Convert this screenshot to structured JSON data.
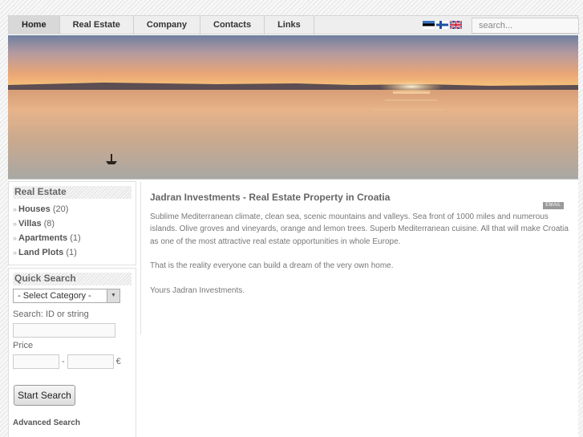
{
  "nav": {
    "items": [
      {
        "label": "Home",
        "active": true
      },
      {
        "label": "Real Estate"
      },
      {
        "label": "Company"
      },
      {
        "label": "Contacts"
      },
      {
        "label": "Links"
      }
    ],
    "flags": [
      "estonia-flag-icon",
      "finland-flag-icon",
      "uk-flag-icon"
    ],
    "search_placeholder": "search..."
  },
  "sidebar": {
    "real_estate": {
      "title": "Real Estate",
      "items": [
        {
          "name": "Houses",
          "count": "(20)"
        },
        {
          "name": "Villas",
          "count": "(8)"
        },
        {
          "name": "Apartments",
          "count": "(1)"
        },
        {
          "name": "Land Plots",
          "count": "(1)"
        }
      ]
    },
    "quick_search": {
      "title": "Quick Search",
      "category_selected": "- Select Category -",
      "search_label": "Search: ID or string",
      "price_label": "Price",
      "price_separator": "-",
      "currency": "€",
      "button": "Start Search",
      "advanced": "Advanced Search"
    }
  },
  "content": {
    "title": "Jadran Investments - Real Estate Property in Croatia",
    "email_badge": "EMAIL",
    "p1": "Sublime Mediterranean climate, clean sea, scenic mountains and valleys. Sea front of 1000 miles and numerous islands. Olive groves and vineyards, orange and lemon trees. Superb Mediterranean cuisine. All that will make Croatia as one of the most attractive real estate opportunities in whole Europe.",
    "p2": "That is the reality everyone can build a dream of the very own home.",
    "p3": "Yours Jadran Investments."
  }
}
